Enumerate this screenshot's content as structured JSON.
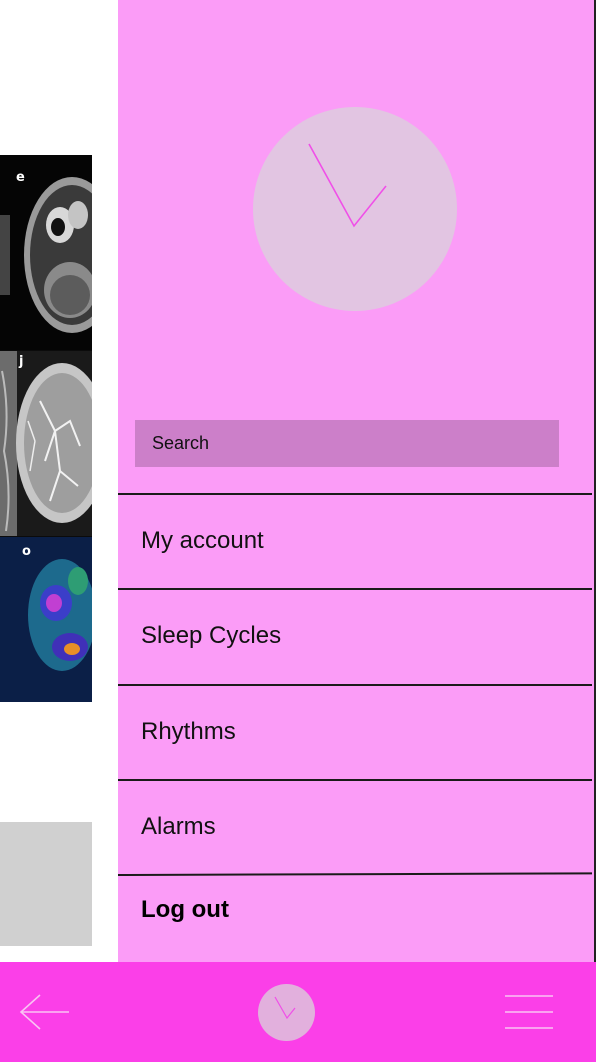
{
  "search": {
    "placeholder": "Search"
  },
  "menu": {
    "items": [
      {
        "label": "My account"
      },
      {
        "label": "Sleep Cycles"
      },
      {
        "label": "Rhythms"
      },
      {
        "label": "Alarms"
      },
      {
        "label": "Log out"
      }
    ]
  },
  "background": {
    "scan_labels": [
      "e",
      "j",
      "o"
    ]
  },
  "colors": {
    "drawer": "#fb9cf7",
    "search_box": "#cc7fc9",
    "logo_circle": "#e2c5e2",
    "clock_hands": "#f04fe8",
    "bottom_bar": "#fb3fe8",
    "bottom_icons": "#f9c3f3"
  },
  "icons": {
    "logo": "clock-hands-icon",
    "back": "arrow-left-icon",
    "home": "clock-home-icon",
    "menu": "hamburger-menu-icon"
  }
}
